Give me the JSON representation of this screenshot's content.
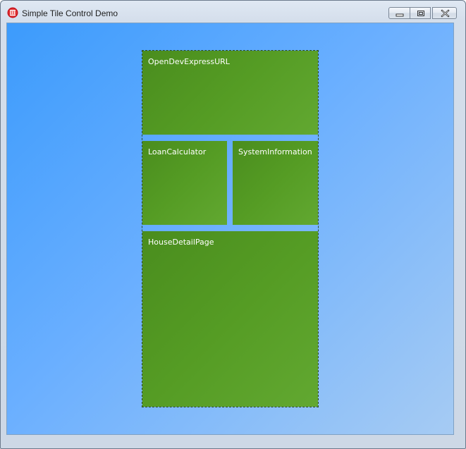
{
  "window": {
    "title": "Simple Tile Control Demo",
    "icon": "devexpress-logo-icon"
  },
  "caption_buttons": [
    "minimize-icon",
    "restore-icon",
    "close-icon"
  ],
  "tiles": [
    {
      "label": "OpenDevExpressURL"
    },
    {
      "label": "LoanCalculator"
    },
    {
      "label": "SystemInformation"
    },
    {
      "label": "HouseDetailPage"
    }
  ],
  "colors": {
    "tile_green": "#559c24",
    "background_blue": "#3c9bfc",
    "background_light": "#a6cbf3"
  }
}
